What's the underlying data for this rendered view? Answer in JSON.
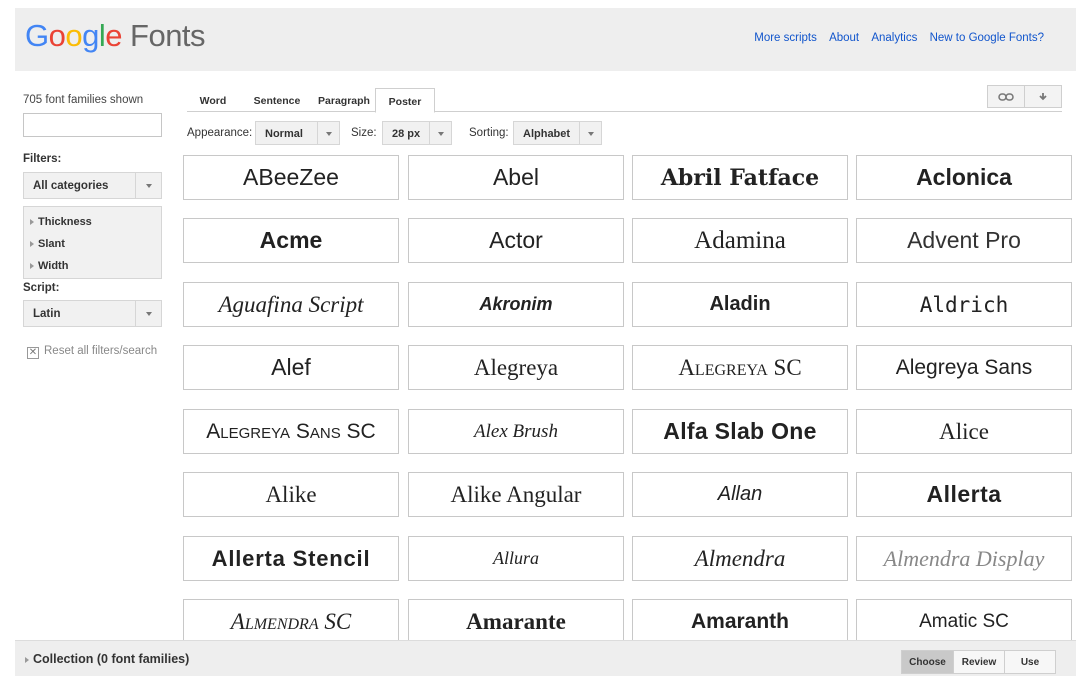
{
  "header": {
    "logo_letters": [
      "G",
      "o",
      "o",
      "g",
      "l",
      "e"
    ],
    "logo_suffix": "Fonts",
    "links": [
      "More scripts",
      "About",
      "Analytics",
      "New to Google Fonts?"
    ]
  },
  "sidebar": {
    "count_label": "705 font families shown",
    "search_value": "",
    "filters_label": "Filters:",
    "category_value": "All categories",
    "filter_items": [
      "Thickness",
      "Slant",
      "Width"
    ],
    "script_label": "Script:",
    "script_value": "Latin",
    "reset_label": "Reset all filters/search"
  },
  "tabs": [
    "Word",
    "Sentence",
    "Paragraph",
    "Poster"
  ],
  "active_tab": "Poster",
  "toolbar": {
    "link_icon": "link-icon",
    "download_icon": "download-icon"
  },
  "controls": {
    "appearance_label": "Appearance:",
    "appearance_value": "Normal",
    "size_label": "Size:",
    "size_value": "28 px",
    "sorting_label": "Sorting:",
    "sorting_value": "Alphabet"
  },
  "fonts": [
    "ABeeZee",
    "Abel",
    "Abril Fatface",
    "Aclonica",
    "Acme",
    "Actor",
    "Adamina",
    "Advent Pro",
    "Aguafina Script",
    "Akronim",
    "Aladin",
    "Aldrich",
    "Alef",
    "Alegreya",
    "Alegreya SC",
    "Alegreya Sans",
    "Alegreya Sans SC",
    "Alex Brush",
    "Alfa Slab One",
    "Alice",
    "Alike",
    "Alike Angular",
    "Allan",
    "Allerta",
    "Allerta Stencil",
    "Allura",
    "Almendra",
    "Almendra Display",
    "Almendra SC",
    "Amarante",
    "Amaranth",
    "Amatic SC"
  ],
  "footer": {
    "collection_label": "Collection (0 font families)",
    "buttons": [
      "Choose",
      "Review",
      "Use"
    ],
    "active_button": "Choose"
  },
  "colors": {
    "google_blue": "#4285f4",
    "google_red": "#ea4335",
    "google_yellow": "#fbbc05",
    "google_green": "#34a853",
    "link_blue": "#1155cc"
  }
}
